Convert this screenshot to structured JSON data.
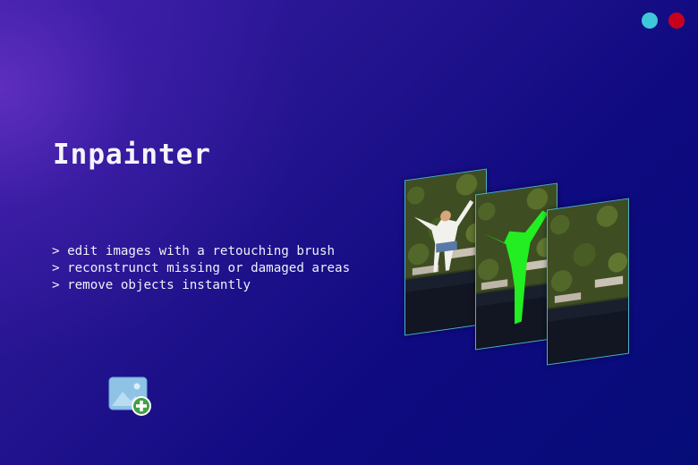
{
  "app": {
    "title": "Inpainter"
  },
  "window_controls": [
    {
      "name": "cyan-dot-button",
      "color": "#3ec7d9"
    },
    {
      "name": "red-dot-button",
      "color": "#c8001e"
    }
  ],
  "features": [
    "> edit images with a retouching brush",
    "> reconstrunct missing or damaged areas",
    "> remove objects instantly"
  ],
  "add_image_button": {
    "icon": "add-image-icon",
    "accent": "#4caf50"
  },
  "preview_panels": [
    {
      "name": "original",
      "description_icon": "photo-person-icon"
    },
    {
      "name": "masked",
      "mask_color": "#22ee22"
    },
    {
      "name": "result",
      "description_icon": "photo-landscape-icon"
    }
  ],
  "colors": {
    "panel_border": "#4ab3c8",
    "mask": "#22ee22",
    "background_dark": "#050c78",
    "background_glow": "#6c34c8"
  }
}
